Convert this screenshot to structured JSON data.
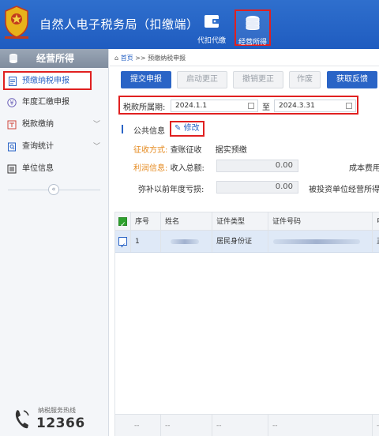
{
  "header": {
    "app_title": "自然人电子税务局（扣缴端）",
    "buttons": [
      {
        "label": "代扣代缴",
        "icon": "wallet-icon"
      },
      {
        "label": "经营所得",
        "icon": "coins-icon"
      }
    ],
    "colors": {
      "bar": "#2f6fcd",
      "highlight_border": "#e02020"
    }
  },
  "sidebar": {
    "title": "经营所得",
    "items": [
      {
        "label": "预缴纳税申报",
        "icon": "document-icon",
        "active": true
      },
      {
        "label": "年度汇缴申报",
        "icon": "yen-circle-icon"
      },
      {
        "label": "税款缴纳",
        "icon": "tax-icon",
        "expandable": true
      },
      {
        "label": "查询统计",
        "icon": "query-icon",
        "expandable": true
      },
      {
        "label": "单位信息",
        "icon": "list-icon"
      }
    ],
    "collapse_symbol": "«",
    "hotline": {
      "label": "纳税服务热线",
      "number": "12366"
    }
  },
  "main": {
    "breadcrumb": {
      "home": "首页",
      "separator": ">>",
      "current": "预缴纳税申报"
    },
    "toolbar": [
      {
        "label": "提交申报",
        "enabled": true
      },
      {
        "label": "启动更正",
        "enabled": false
      },
      {
        "label": "撤销更正",
        "enabled": false
      },
      {
        "label": "作废",
        "enabled": false
      },
      {
        "label": "获取反馈",
        "enabled": true
      }
    ],
    "period": {
      "label": "税款所属期:",
      "start": "2024.1.1",
      "separator": "至",
      "end": "2024.3.31"
    },
    "public_info": {
      "title": "公共信息",
      "modify_label": "修改",
      "levy_label": "征收方式:",
      "levy_value": "查账征收",
      "levy_extra": "据实预缴",
      "profit_label": "利润信息:",
      "income_label": "收入总额:",
      "income_value": "0.00",
      "cost_label": "成本费用",
      "loss_label": "弥补以前年度亏损:",
      "loss_value": "0.00",
      "invested_label": "被投资单位经营所得"
    },
    "table": {
      "columns": [
        "序号",
        "姓名",
        "证件类型",
        "证件号码",
        "申"
      ],
      "rows": [
        {
          "index": "1",
          "name": "",
          "id_type": "居民身份证",
          "id_number": "",
          "extra": "正"
        }
      ],
      "footer": [
        "--",
        "--",
        "--",
        "--",
        "--"
      ]
    }
  }
}
